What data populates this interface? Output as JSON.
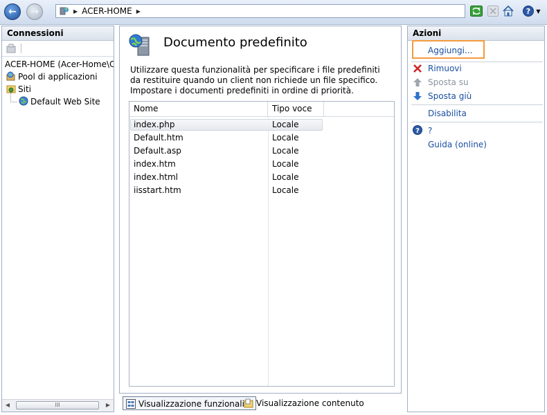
{
  "address": {
    "segments": [
      "ACER-HOME"
    ]
  },
  "connections": {
    "title": "Connessioni",
    "tree": [
      {
        "label": "ACER-HOME (Acer-Home\\Ci",
        "icon": "computer-icon"
      },
      {
        "label": "Pool di applicazioni",
        "icon": "app-pool-icon"
      },
      {
        "label": "Siti",
        "icon": "sites-folder-icon"
      },
      {
        "label": "Default Web Site",
        "icon": "globe-icon"
      }
    ],
    "scroll_grip": "III"
  },
  "feature": {
    "title": "Documento predefinito",
    "description": "Utilizzare questa funzionalità per specificare i file predefiniti da restituire quando un client non richiede un file specifico. Impostare i documenti predefiniti in ordine di priorità.",
    "columns": [
      "Nome",
      "Tipo voce"
    ],
    "rows": [
      {
        "name": "index.php",
        "type": "Locale"
      },
      {
        "name": "Default.htm",
        "type": "Locale"
      },
      {
        "name": "Default.asp",
        "type": "Locale"
      },
      {
        "name": "index.htm",
        "type": "Locale"
      },
      {
        "name": "index.html",
        "type": "Locale"
      },
      {
        "name": "iisstart.htm",
        "type": "Locale"
      }
    ],
    "selected_row": "index.php"
  },
  "views": {
    "features": "Visualizzazione funzionalità",
    "content": "Visualizzazione contenuto"
  },
  "actions": {
    "title": "Azioni",
    "add": "Aggiungi...",
    "remove": "Rimuovi",
    "move_up": "Sposta su",
    "move_down": "Sposta giù",
    "disable": "Disabilita",
    "help": "?",
    "online_help": "Guida (online)"
  },
  "colors": {
    "link": "#1a4fa1",
    "disabled": "#8a939d",
    "highlight": "#f59a3d"
  }
}
